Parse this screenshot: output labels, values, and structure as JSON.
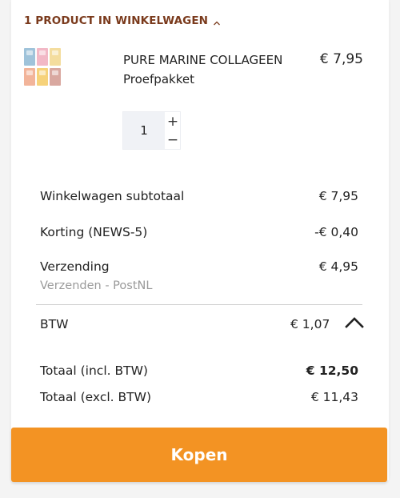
{
  "cart": {
    "header": "1 PRODUCT IN WINKELWAGEN",
    "header_icon": "chevron-up-icon",
    "accent_color": "#7a3a1c"
  },
  "product": {
    "name": "PURE MARINE COLLAGEEN",
    "variant": "Proefpakket",
    "price": "€ 7,95",
    "quantity": "1",
    "plus_label": "+",
    "minus_label": "−",
    "thumbnail_colors": [
      "#9fc3da",
      "#f2b8c6",
      "#f4dd9e",
      "#f2b49a",
      "#f6d27a",
      "#d9a8a0"
    ]
  },
  "summary": {
    "subtotal_label": "Winkelwagen subtotaal",
    "subtotal_value": "€ 7,95",
    "discount_label": "Korting (NEWS-5)",
    "discount_value": "-€ 0,40",
    "shipping_label": "Verzending",
    "shipping_value": "€ 4,95",
    "shipping_method": "Verzenden - PostNL",
    "btw_label": "BTW",
    "btw_value": "€ 1,07",
    "btw_icon": "chevron-up-icon",
    "total_incl_label": "Totaal (incl. BTW)",
    "total_incl_value": "€ 12,50",
    "total_excl_label": "Totaal (excl. BTW)",
    "total_excl_value": "€ 11,43"
  },
  "checkout": {
    "buy_label": "Kopen",
    "button_color": "#f39323"
  }
}
